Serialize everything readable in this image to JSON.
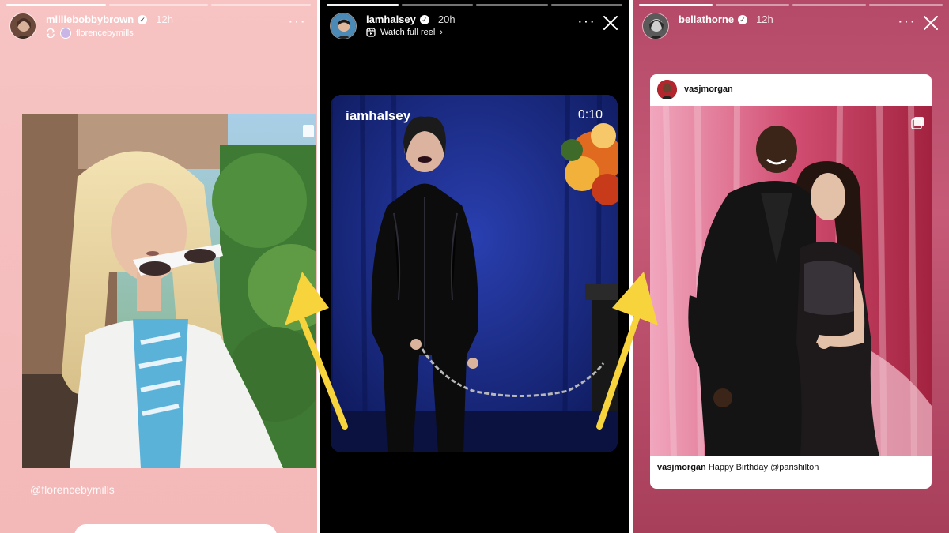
{
  "stories": [
    {
      "username": "milliebobbybrown",
      "time": "12h",
      "reshared_from": "florencebymills",
      "mention_sticker": "@florencebymills",
      "progress": {
        "segments": 3,
        "active_index": 0
      }
    },
    {
      "username": "iamhalsey",
      "time": "20h",
      "cta": "Watch full reel",
      "reel": {
        "overlay_user": "iamhalsey",
        "duration": "0:10"
      },
      "progress": {
        "segments": 4,
        "active_index": 0
      }
    },
    {
      "username": "bellathorne",
      "time": "12h",
      "shared_post": {
        "author": "vasjmorgan",
        "caption_user": "vasjmorgan",
        "caption_text": "Happy Birthday @parishilton"
      },
      "progress": {
        "segments": 4,
        "active_index": 0
      }
    }
  ],
  "icons": {
    "more": "more-options-icon",
    "close": "close-icon",
    "verified": "verified-badge-icon",
    "reshare": "reshare-icon",
    "reel": "reel-icon",
    "multi_photo": "multi-photo-icon",
    "shop": "shopping-bag-icon"
  },
  "colors": {
    "annotation_arrow": "#f7d33c",
    "panel1_bg": "#f5bdbd",
    "panel3_bg": "#b44a68"
  },
  "chevron": "›"
}
